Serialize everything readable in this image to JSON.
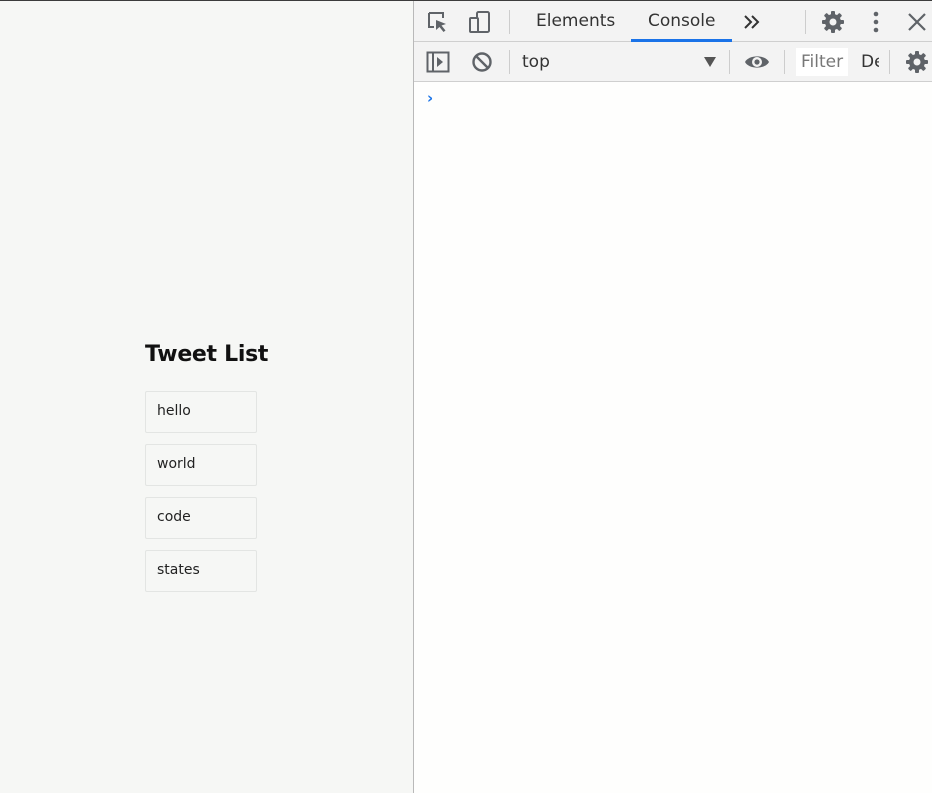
{
  "page": {
    "title": "Tweet List",
    "tweets": [
      "hello",
      "world",
      "code",
      "states"
    ]
  },
  "devtools": {
    "tabs": [
      {
        "label": "Elements",
        "active": false
      },
      {
        "label": "Console",
        "active": true
      }
    ],
    "more_tabs_icon": "double-chevron-right-icon",
    "context": "top",
    "filter_placeholder": "Filter",
    "levels_label": "Default levels",
    "prompt_symbol": "›",
    "colors": {
      "accent": "#1a73e8",
      "toolbar_bg": "#f3f3f3",
      "page_bg": "#f6f7f5"
    }
  }
}
